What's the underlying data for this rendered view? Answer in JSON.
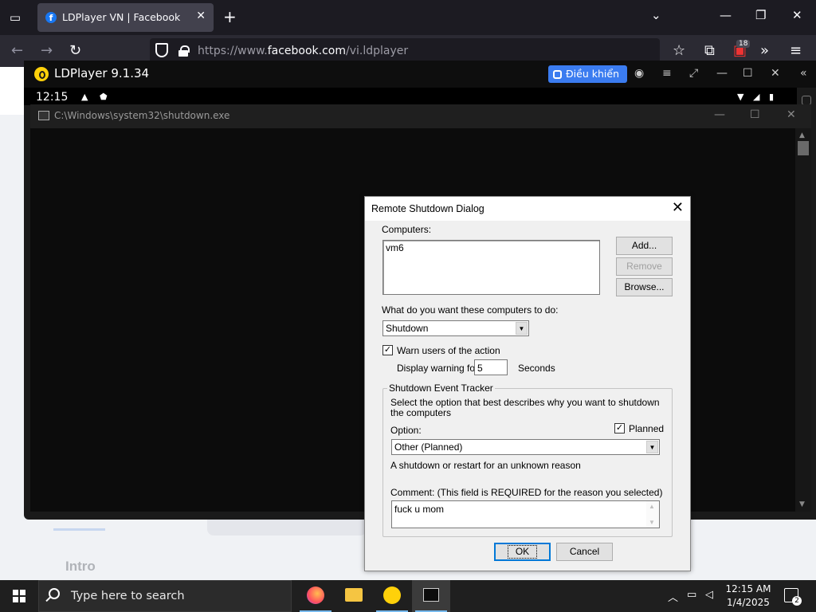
{
  "browser": {
    "tab_title": "LDPlayer VN | Facebook",
    "url_prefix": "https://www.",
    "url_domain": "facebook.com",
    "url_path": "/vi.ldplayer",
    "extension_badge": "18"
  },
  "ldplayer": {
    "title": "LDPlayer 9.1.34",
    "control_button": "Điều khiển",
    "android_time": "12:15"
  },
  "cmd": {
    "title": "C:\\Windows\\system32\\shutdown.exe"
  },
  "dialog": {
    "title": "Remote Shutdown Dialog",
    "computers_label": "Computers:",
    "computers": [
      "vm6"
    ],
    "add_button": "Add...",
    "remove_button": "Remove",
    "browse_button": "Browse...",
    "action_question": "What do you want these computers to do:",
    "action_value": "Shutdown",
    "warn_checked": true,
    "warn_label": "Warn users of the action",
    "display_warning_label": "Display warning for",
    "warning_seconds": "5",
    "seconds_label": "Seconds",
    "tracker_title": "Shutdown Event Tracker",
    "tracker_desc": "Select the option that best describes why you want to shutdown the computers",
    "option_label": "Option:",
    "planned_checked": true,
    "planned_label": "Planned",
    "option_value": "Other (Planned)",
    "option_desc": "A shutdown or restart for an unknown reason",
    "comment_label": "Comment: (This field is REQUIRED for the reason you selected)",
    "comment_value": "fuck u mom",
    "ok_button": "OK",
    "cancel_button": "Cancel"
  },
  "page": {
    "intro": "Intro"
  },
  "taskbar": {
    "search_placeholder": "Type here to search",
    "time": "12:15 AM",
    "date": "1/4/2025",
    "notification_count": "2"
  }
}
